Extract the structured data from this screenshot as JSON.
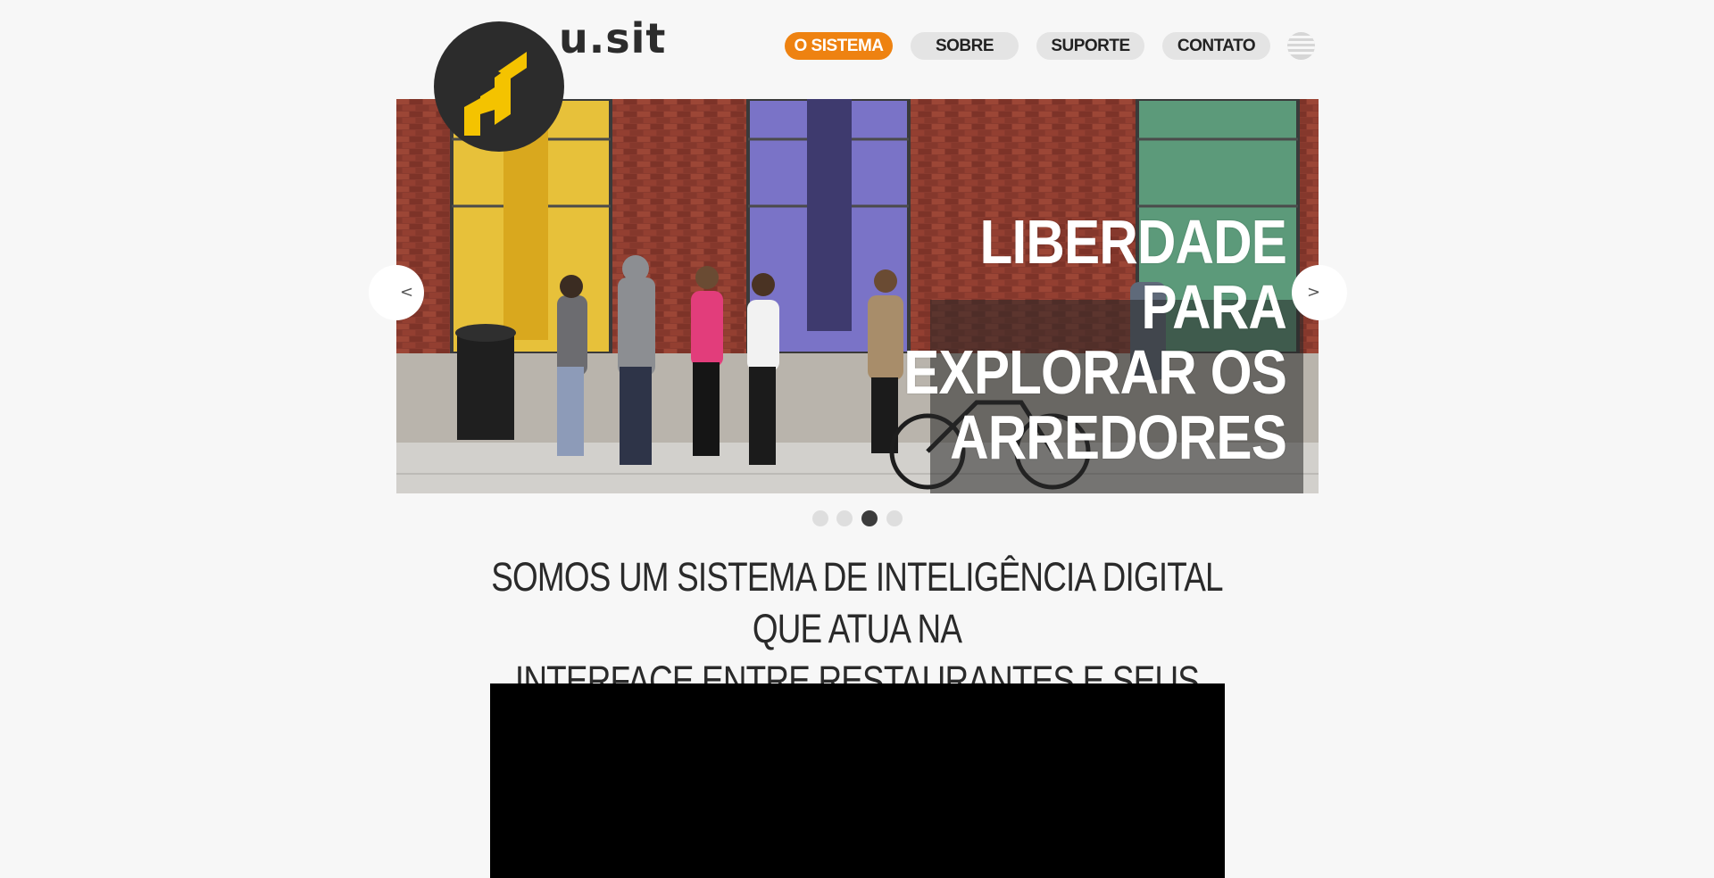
{
  "brand": {
    "name": "u.sit"
  },
  "nav": {
    "items": [
      {
        "label": "O SISTEMA",
        "active": true
      },
      {
        "label": "SOBRE",
        "active": false
      },
      {
        "label": "SUPORTE",
        "active": false
      },
      {
        "label": "CONTATO",
        "active": false
      }
    ],
    "language_icon": "striped-globe-icon"
  },
  "hero": {
    "caption_lines": [
      "LIBERDADE",
      "PARA",
      "EXPLORAR OS",
      "ARREDORES"
    ],
    "prev_label": "<",
    "next_label": ">",
    "slide_count": 4,
    "active_slide": 3
  },
  "tagline": {
    "line1": "SOMOS UM SISTEMA DE INTELIGÊNCIA DIGITAL QUE ATUA NA",
    "line2": "INTERFACE ENTRE RESTAURANTES E SEUS CLIENTES"
  },
  "colors": {
    "accent": "#ee8211",
    "logo_yellow": "#f4c300",
    "logo_bg": "#2c2c2c",
    "page_bg": "#f7f7f7"
  }
}
